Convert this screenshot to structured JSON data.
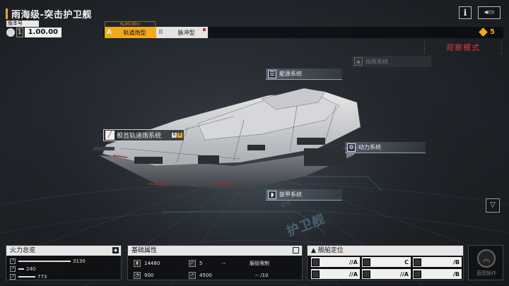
{
  "header": {
    "title": "雨海级-突击护卫舰",
    "version_label": "版本号",
    "version_major": "1",
    "version_value": "1.00.00",
    "currency_value": "5"
  },
  "modes": {
    "header_label": "YL00-00>",
    "items": [
      {
        "key": "A",
        "label": "轨道炮型"
      },
      {
        "key": "B",
        "label": "脉冲型"
      }
    ]
  },
  "buttons": {
    "info": "i",
    "back": "◂▭"
  },
  "observe_mode": "观察模式",
  "systems": {
    "command": "指挥系统",
    "energy": "能源系统",
    "weapon": "舰首轨道炮系统",
    "power": "动力系统",
    "armor": "装甲系统"
  },
  "hull_text": "护卫舰",
  "hull_code": "270",
  "firepower": {
    "title": "火力总览",
    "rows": [
      {
        "icon": "shell-icon",
        "value": "3130",
        "fraction": 0.92
      },
      {
        "icon": "antiair-icon",
        "value": "240",
        "fraction": 0.1
      },
      {
        "icon": "siege-icon",
        "value": "773",
        "fraction": 0.3
      }
    ]
  },
  "attributes": {
    "title": "基础属性",
    "hp": "14480",
    "armor": "5",
    "armor_extra": "--",
    "speed": "900",
    "range": "4500",
    "service_limit_label": "服役限制",
    "service_limit_value": "-- /10"
  },
  "positioning": {
    "title": "舰船定位",
    "cells": [
      {
        "icon": "frontline-icon",
        "value": "//A"
      },
      {
        "icon": "ship-cell-icon",
        "value": "C"
      },
      {
        "icon": "tank-icon",
        "value": "/B"
      },
      {
        "icon": "support-icon",
        "value": "//A"
      },
      {
        "icon": "assault-icon",
        "value": "//A"
      },
      {
        "icon": "gear-cell-icon",
        "value": "/B"
      }
    ]
  },
  "fleet_button": "蓝图操作",
  "colors": {
    "accent": "#f2a91c",
    "alert": "#d23a3a",
    "system_blue": "#2a3550"
  }
}
